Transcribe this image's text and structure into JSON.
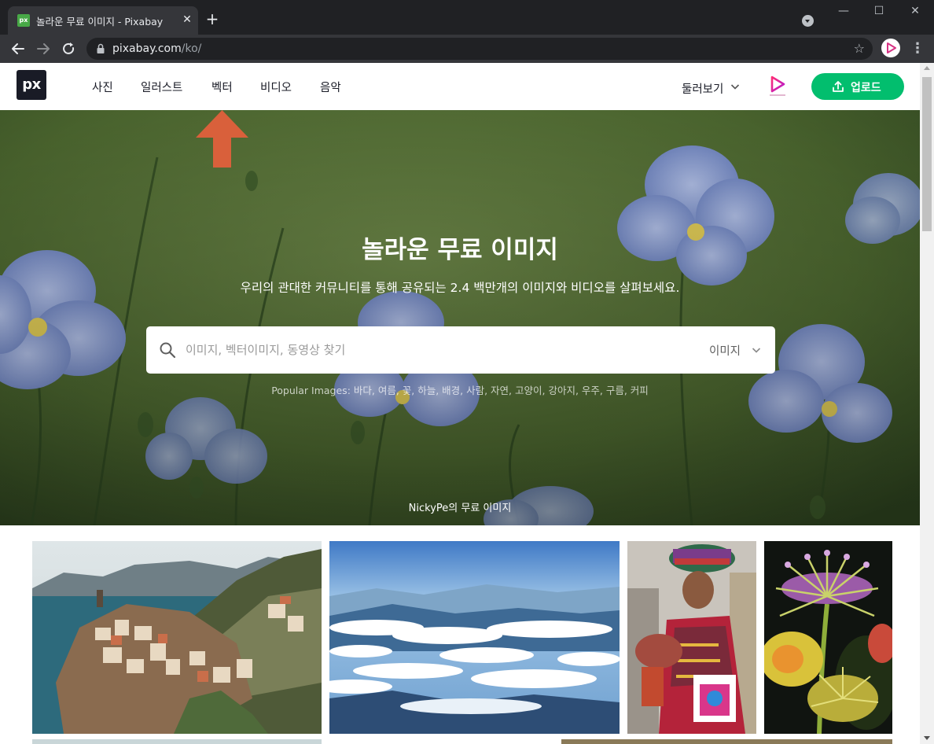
{
  "browser": {
    "tab_title": "놀라운 무료 이미지 - Pixabay",
    "tab_favicon_text": "px",
    "tab_close": "✕",
    "new_tab": "+",
    "window_controls": {
      "minimize": "—",
      "maximize": "☐",
      "close": "✕"
    },
    "url_domain": "pixabay.com",
    "url_path": "/ko/",
    "bookmark_star": "☆",
    "menu": "⋮"
  },
  "site": {
    "logo_text": "px",
    "nav": [
      "사진",
      "일러스트",
      "벡터",
      "비디오",
      "음악"
    ],
    "explore_label": "둘러보기",
    "upload_label": "업로드"
  },
  "hero": {
    "title": "놀라운 무료 이미지",
    "subtitle": "우리의 관대한 커뮤니티를 통해 공유되는 2.4 백만개의 이미지와 비디오를 살펴보세요.",
    "search_placeholder": "이미지, 벡터이미지, 동영상 찾기",
    "search_type": "이미지",
    "popular_text": "Popular Images: 바다, 여름, 꽃, 하늘, 배경, 사람, 자연, 고양이, 강아지, 우주, 구름, 커피",
    "credit": "NickyPe의 무료 이미지"
  },
  "colors": {
    "chrome_dark": "#202124",
    "chrome_tab": "#35363a",
    "brand_dark": "#191b26",
    "upload_green": "#02be6e",
    "annotation_arrow": "#d9603b"
  },
  "icons": [
    "back-arrow-icon",
    "forward-arrow-icon",
    "reload-icon",
    "lock-icon",
    "star-icon",
    "search-icon",
    "chevron-down-icon",
    "upload-icon",
    "play-logo-icon"
  ]
}
